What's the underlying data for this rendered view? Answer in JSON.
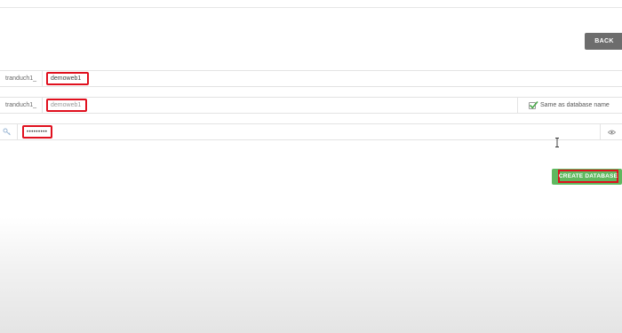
{
  "header": {
    "back_label": "BACK"
  },
  "database_name": {
    "prefix": "tranduch1_",
    "value": "demoweb1"
  },
  "username": {
    "prefix": "tranduch1_",
    "value": "demoweb1",
    "same_as_db_label": "Same as database name",
    "same_as_db_checked": true
  },
  "password": {
    "masked_value": "•••••••••"
  },
  "actions": {
    "create_label": "CREATE DATABASE"
  },
  "colors": {
    "back_bg": "#6d6d6d",
    "create_bg": "#5fb85f",
    "highlight": "#e0101e"
  },
  "icons": {
    "password_field": "key-icon",
    "reveal": "eye-icon",
    "mouse": "text-cursor-icon",
    "checkbox": "checkmark-icon"
  }
}
